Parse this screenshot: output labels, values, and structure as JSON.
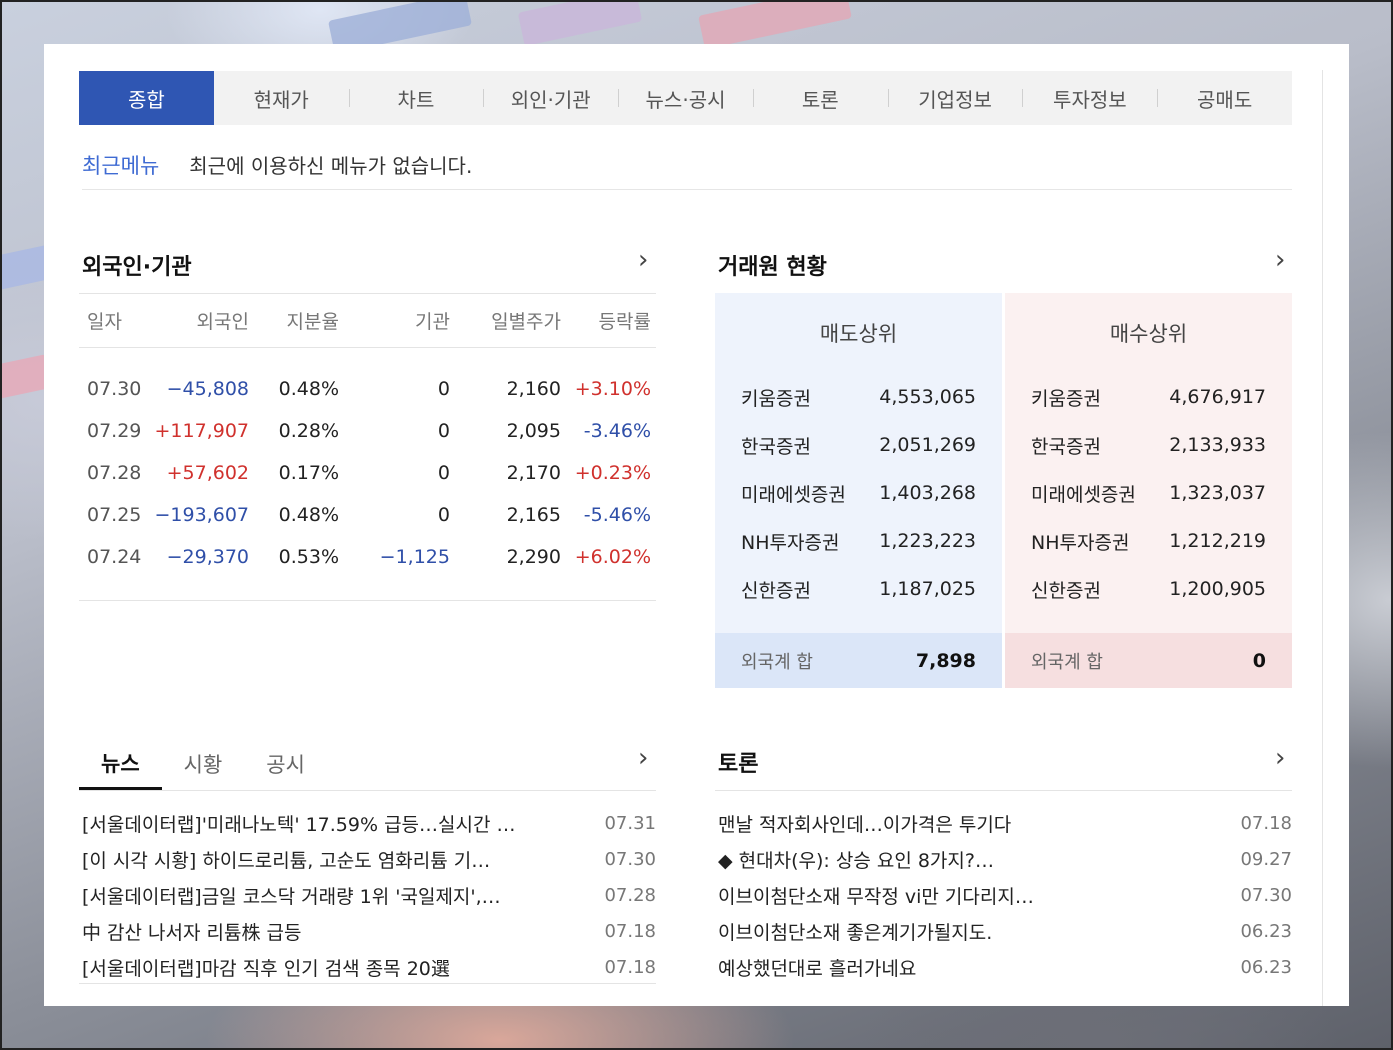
{
  "tabs": [
    "종합",
    "현재가",
    "차트",
    "외인·기관",
    "뉴스·공시",
    "토론",
    "기업정보",
    "투자정보",
    "공매도"
  ],
  "recent": {
    "label": "최근메뉴",
    "message": "최근에 이용하신 메뉴가 없습니다."
  },
  "foreign": {
    "title": "외국인·기관",
    "headers": [
      "일자",
      "외국인",
      "지분율",
      "기관",
      "일별주가",
      "등락률"
    ],
    "rows": [
      [
        "07.30",
        "−45,808",
        "0.48%",
        "0",
        "2,160",
        "+3.10%"
      ],
      [
        "07.29",
        "+117,907",
        "0.28%",
        "0",
        "2,095",
        "-3.46%"
      ],
      [
        "07.28",
        "+57,602",
        "0.17%",
        "0",
        "2,170",
        "+0.23%"
      ],
      [
        "07.25",
        "−193,607",
        "0.48%",
        "0",
        "2,165",
        "-5.46%"
      ],
      [
        "07.24",
        "−29,370",
        "0.53%",
        "−1,125",
        "2,290",
        "+6.02%"
      ]
    ]
  },
  "broker": {
    "title": "거래원 현황",
    "sell": {
      "header": "매도상위",
      "rows": [
        [
          "키움증권",
          "4,553,065"
        ],
        [
          "한국증권",
          "2,051,269"
        ],
        [
          "미래에셋증권",
          "1,403,268"
        ],
        [
          "NH투자증권",
          "1,223,223"
        ],
        [
          "신한증권",
          "1,187,025"
        ]
      ],
      "footer_label": "외국계 합",
      "footer_value": "7,898"
    },
    "buy": {
      "header": "매수상위",
      "rows": [
        [
          "키움증권",
          "4,676,917"
        ],
        [
          "한국증권",
          "2,133,933"
        ],
        [
          "미래에셋증권",
          "1,323,037"
        ],
        [
          "NH투자증권",
          "1,212,219"
        ],
        [
          "신한증권",
          "1,200,905"
        ]
      ],
      "footer_label": "외국계 합",
      "footer_value": "0"
    }
  },
  "news": {
    "tabs": [
      "뉴스",
      "시황",
      "공시"
    ],
    "items": [
      [
        "[서울데이터랩]'미래나노텍' 17.59% 급등…실시간 …",
        "07.31"
      ],
      [
        "[이 시각 시황] 하이드로리튬, 고순도 염화리튬 기…",
        "07.30"
      ],
      [
        "[서울데이터랩]금일 코스닥 거래량 1위 '국일제지',…",
        "07.28"
      ],
      [
        "中 감산 나서자 리튬株 급등",
        "07.18"
      ],
      [
        "[서울데이터랩]마감 직후 인기 검색 종목 20選",
        "07.18"
      ]
    ]
  },
  "discussion": {
    "title": "토론",
    "items": [
      [
        "맨날 적자회사인데…이가격은 투기다",
        "07.18"
      ],
      [
        "◆ 현대차(우): 상승 요인 8가지?…",
        "09.27"
      ],
      [
        "이브이첨단소재 무작정 vi만 기다리지…",
        "07.30"
      ],
      [
        "이브이첨단소재 좋은계기가될지도.",
        "06.23"
      ],
      [
        "예상했던대로 흘러가네요",
        "06.23"
      ]
    ]
  },
  "colors": {
    "accent": "#2f56b3",
    "up": "#d0312d",
    "down": "#2f4fa8"
  }
}
